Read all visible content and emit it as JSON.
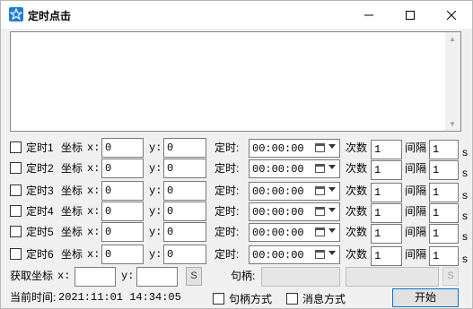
{
  "window": {
    "title": "定时点击",
    "icons": {
      "app": "star-icon",
      "minimize": "minimize-icon",
      "maximize": "maximize-icon",
      "close": "close-icon"
    },
    "accent": "#1e7fd6"
  },
  "log_area": {
    "content": ""
  },
  "timers": [
    {
      "label": "定时1",
      "coord_label": "坐标",
      "x_label": "x:",
      "x": "0",
      "y_label": "y:",
      "y": "0",
      "time_label": "定时:",
      "time": "00:00:00",
      "count_label": "次数",
      "count": "1",
      "interval_label": "间隔",
      "interval": "1",
      "unit": "s"
    },
    {
      "label": "定时2",
      "coord_label": "坐标",
      "x_label": "x:",
      "x": "0",
      "y_label": "y:",
      "y": "0",
      "time_label": "定时:",
      "time": "00:00:00",
      "count_label": "次数",
      "count": "1",
      "interval_label": "间隔",
      "interval": "1",
      "unit": "s"
    },
    {
      "label": "定时3",
      "coord_label": "坐标",
      "x_label": "x:",
      "x": "0",
      "y_label": "y:",
      "y": "0",
      "time_label": "定时:",
      "time": "00:00:00",
      "count_label": "次数",
      "count": "1",
      "interval_label": "间隔",
      "interval": "1",
      "unit": "s"
    },
    {
      "label": "定时4",
      "coord_label": "坐标",
      "x_label": "x:",
      "x": "0",
      "y_label": "y:",
      "y": "0",
      "time_label": "定时:",
      "time": "00:00:00",
      "count_label": "次数",
      "count": "1",
      "interval_label": "间隔",
      "interval": "1",
      "unit": "s"
    },
    {
      "label": "定时5",
      "coord_label": "坐标",
      "x_label": "x:",
      "x": "0",
      "y_label": "y:",
      "y": "0",
      "time_label": "定时:",
      "time": "00:00:00",
      "count_label": "次数",
      "count": "1",
      "interval_label": "间隔",
      "interval": "1",
      "unit": "s"
    },
    {
      "label": "定时6",
      "coord_label": "坐标",
      "x_label": "x:",
      "x": "0",
      "y_label": "y:",
      "y": "0",
      "time_label": "定时:",
      "time": "00:00:00",
      "count_label": "次数",
      "count": "1",
      "interval_label": "间隔",
      "interval": "1",
      "unit": "s"
    }
  ],
  "capture": {
    "label": "获取坐标",
    "x_label": "x:",
    "x": "",
    "y_label": "y:",
    "y": "",
    "s_button": "S",
    "handle_label": "句柄:",
    "handle": "",
    "handle_extra": "",
    "s_button2": "S"
  },
  "footer": {
    "current_time_label": "当前时间:",
    "current_time": "2021:11:01 14:34:05",
    "mode_handle": "句柄方式",
    "mode_message": "消息方式",
    "start_button": "开始"
  }
}
